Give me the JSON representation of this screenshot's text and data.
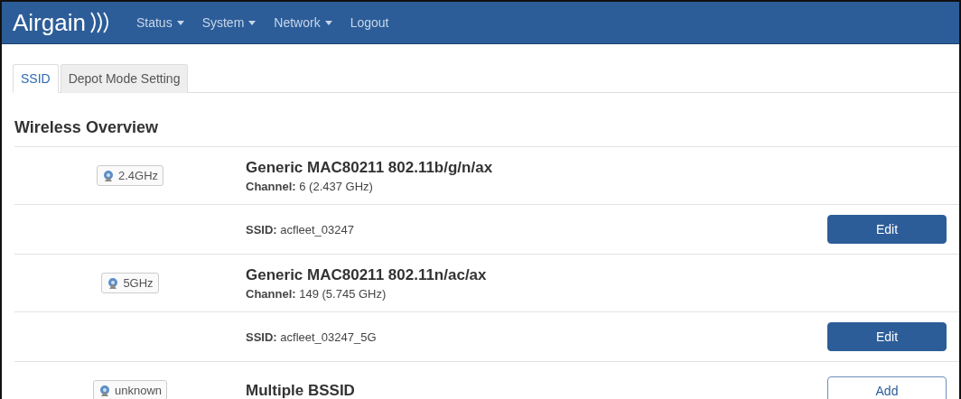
{
  "navbar": {
    "logo": "Airgain",
    "menu": [
      {
        "label": "Status",
        "dropdown": true
      },
      {
        "label": "System",
        "dropdown": true
      },
      {
        "label": "Network",
        "dropdown": true
      },
      {
        "label": "Logout",
        "dropdown": false
      }
    ]
  },
  "tabs": [
    {
      "label": "SSID",
      "selected": true
    },
    {
      "label": "Depot Mode Setting",
      "selected": false
    }
  ],
  "section": {
    "title": "Wireless Overview",
    "rows": [
      {
        "kind": "device",
        "badge": "2.4GHz",
        "title": "Generic MAC80211 802.11b/g/n/ax",
        "detail": "**Channel:** 6 (2.437 GHz)"
      },
      {
        "kind": "network",
        "detail": "**SSID:** acfleet_03247",
        "button": {
          "label": "Edit",
          "kind": "primary"
        }
      },
      {
        "kind": "device",
        "badge": "5GHz",
        "title": "Generic MAC80211 802.11n/ac/ax",
        "detail": "**Channel:** 149 (5.745 GHz)"
      },
      {
        "kind": "network",
        "detail": "**SSID:** acfleet_03247_5G",
        "button": {
          "label": "Edit",
          "kind": "primary"
        }
      },
      {
        "kind": "device",
        "badge": "unknown",
        "title": "Multiple BSSID",
        "button": {
          "label": "Add",
          "kind": "default"
        }
      }
    ]
  }
}
